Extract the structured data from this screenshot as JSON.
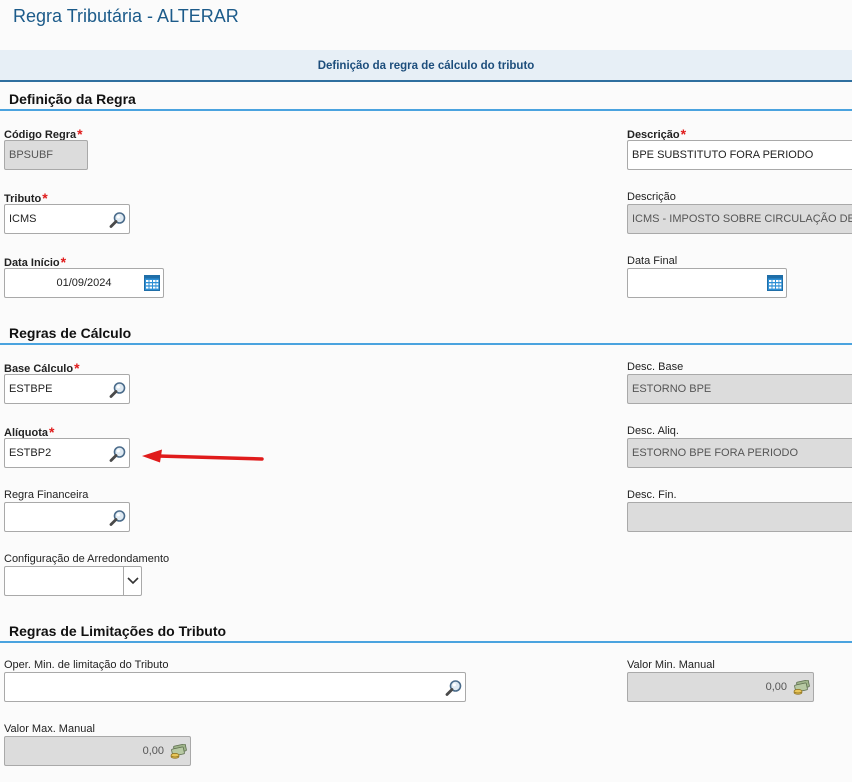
{
  "page_title": "Regra Tributária - ALTERAR",
  "banner_title": "Definição da regra de cálculo do tributo",
  "sections": {
    "definicao": "Definição da Regra",
    "calculo": "Regras de Cálculo",
    "limitacoes": "Regras de Limitações do Tributo"
  },
  "required_mark": "*",
  "fields": {
    "codigo_regra": {
      "label": "Código Regra",
      "value": "BPSUBF"
    },
    "descricao": {
      "label": "Descrição",
      "value": "BPE SUBSTITUTO FORA PERIODO"
    },
    "tributo": {
      "label": "Tributo",
      "value": "ICMS"
    },
    "tributo_desc": {
      "label": "Descrição",
      "value": "ICMS - IMPOSTO SOBRE CIRCULAÇÃO DE"
    },
    "data_inicio": {
      "label": "Data Início",
      "value": "01/09/2024"
    },
    "data_final": {
      "label": "Data Final",
      "value": " /  /"
    },
    "base_calculo": {
      "label": "Base Cálculo",
      "value": "ESTBPE"
    },
    "desc_base": {
      "label": "Desc. Base",
      "value": "ESTORNO BPE"
    },
    "aliquota": {
      "label": "Alíquota",
      "value": "ESTBP2"
    },
    "desc_aliq": {
      "label": "Desc. Aliq.",
      "value": "ESTORNO BPE FORA PERIODO"
    },
    "regra_financeira": {
      "label": "Regra Financeira",
      "value": ""
    },
    "desc_fin": {
      "label": "Desc. Fin.",
      "value": ""
    },
    "arredondamento": {
      "label": "Configuração de Arredondamento",
      "value": ""
    },
    "oper_min": {
      "label": "Oper. Min. de limitação do Tributo",
      "value": ""
    },
    "valor_min": {
      "label": "Valor Min. Manual",
      "value": "0,00"
    },
    "valor_max": {
      "label": "Valor Max. Manual",
      "value": "0,00"
    }
  },
  "icons": {
    "lookup": "magnifier-icon",
    "date": "calendar-icon",
    "currency": "money-icon",
    "dropdown": "chevron-down-icon",
    "annotation": "red-arrow-annotation"
  },
  "colors": {
    "title": "#1c5b8a",
    "banner_bg": "#e7eff6",
    "section_rule": "#4aa3df",
    "required": "#e01b1b",
    "readonly_bg": "#dcdcdc",
    "annotation": "#e01b1b"
  }
}
